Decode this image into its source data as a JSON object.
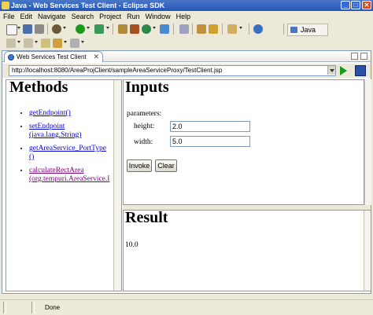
{
  "window": {
    "title": "Java - Web Services Test Client - Eclipse SDK",
    "controls": [
      "_",
      "□",
      "✕"
    ]
  },
  "menu": [
    "File",
    "Edit",
    "Navigate",
    "Search",
    "Project",
    "Run",
    "Window",
    "Help"
  ],
  "perspective": {
    "label": "Java"
  },
  "editor": {
    "tab_label": "Web Services Test Client",
    "tab_close": "✕",
    "url": "http://localhost:8080/AreaProjClient/sampleAreaServiceProxy/TestClient.jsp"
  },
  "methods": {
    "heading": "Methods",
    "items": [
      {
        "label": "getEndpoint()"
      },
      {
        "label": "setEndpoint",
        "label2": "(java.lang.String)"
      },
      {
        "label": "getAreaService_PortType",
        "label2": "()"
      },
      {
        "label": "calculateRectArea",
        "label2": "(org.tempuri.AreaService.I"
      }
    ]
  },
  "inputs": {
    "heading": "Inputs",
    "parameters_label": "parameters:",
    "height_label": "height:",
    "height_value": "2.0",
    "width_label": "width:",
    "width_value": "5.0",
    "invoke_label": "Invoke",
    "clear_label": "Clear"
  },
  "result": {
    "heading": "Result",
    "value": "10.0"
  },
  "status": {
    "text": "Done"
  },
  "colors": {
    "title_bar": "#2456b8",
    "link": "#0000cc",
    "visited_link": "#800080",
    "go_arrow": "#1a9a1a"
  }
}
